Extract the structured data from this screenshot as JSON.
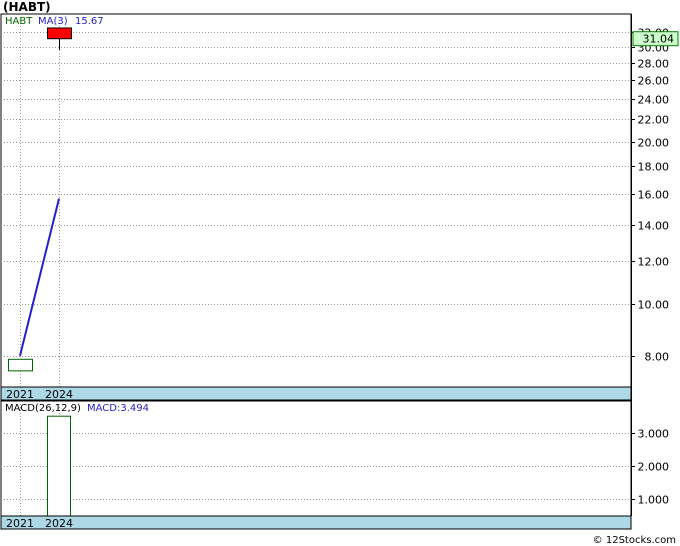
{
  "title": "(HABT)",
  "copyright": "© 12Stocks.com",
  "colors": {
    "up_candle": "#ff0000",
    "down_candle": "#ffffff",
    "ma_line": "#2222cc",
    "histogram": "#006400",
    "axis_band": "#add8e6",
    "last_price_box": "#ccffcc",
    "grid": "#999999"
  },
  "chart_data": [
    {
      "type": "candlestick",
      "panel": "price",
      "legend": {
        "ticker": "HABT",
        "ma_label": "MA(3)",
        "ma_value": "15.67"
      },
      "x": [
        "2021",
        "2024"
      ],
      "candles": [
        {
          "x": "2021",
          "open": 7.88,
          "high": 7.88,
          "low": 7.5,
          "close": 7.5
        },
        {
          "x": "2024",
          "open": 31.04,
          "high": 31.04,
          "low": 29.6,
          "close": 32.5
        }
      ],
      "ma": [
        {
          "x": "2021",
          "y": 8.0
        },
        {
          "x": "2024",
          "y": 15.67
        }
      ],
      "last_price": "31.04",
      "y_scale": "log",
      "ylim": [
        7.0,
        34.5
      ],
      "y_ticks": [
        "8.00",
        "10.00",
        "12.00",
        "14.00",
        "16.00",
        "18.00",
        "20.00",
        "22.00",
        "24.00",
        "26.00",
        "28.00",
        "30.00",
        "32.00"
      ],
      "x_labels": [
        "2021",
        "2024"
      ],
      "grid": true
    },
    {
      "type": "bar",
      "panel": "macd",
      "legend": {
        "label": "MACD(26,12,9)",
        "value_label": "MACD:3.494"
      },
      "x": [
        "2021",
        "2024"
      ],
      "values": [
        0,
        3.494
      ],
      "ylim": [
        0.5,
        3.95
      ],
      "y_ticks": [
        "1.000",
        "2.000",
        "3.000"
      ],
      "x_labels": [
        "2021",
        "2024"
      ],
      "grid": true
    }
  ]
}
